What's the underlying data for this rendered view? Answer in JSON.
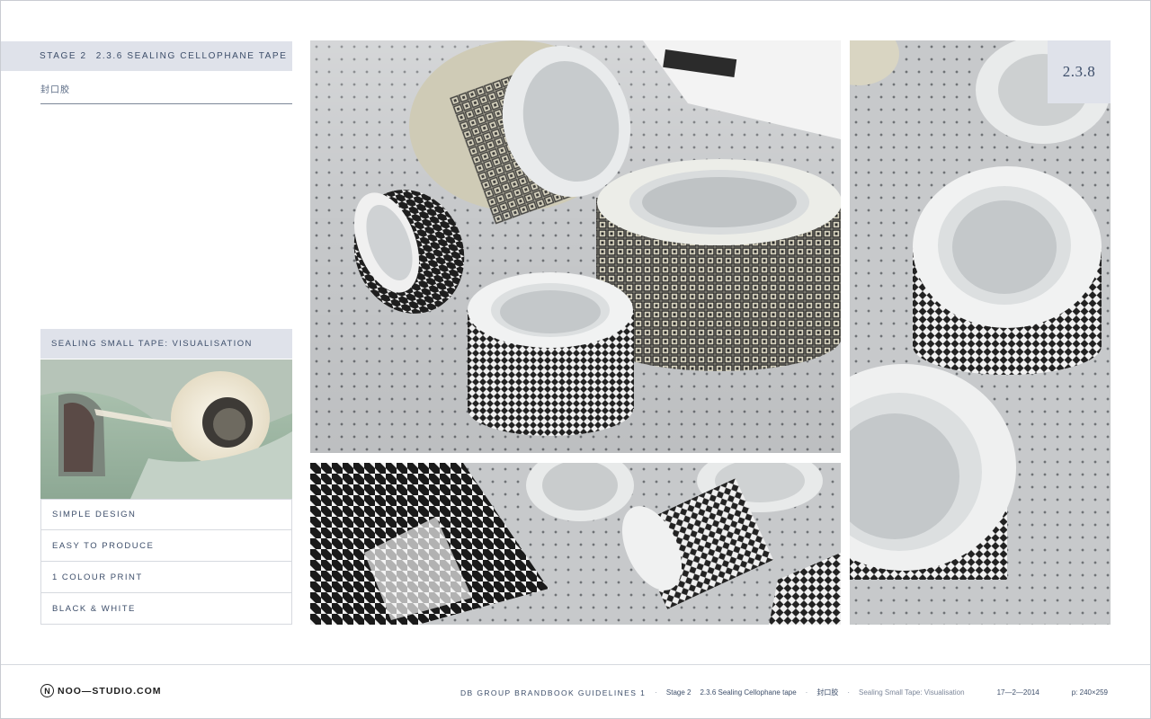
{
  "header": {
    "stage": "Stage 2",
    "section": "2.3.6 Sealing Cellophane tape",
    "chinese_label": "封口胶"
  },
  "visualisation": {
    "title": "Sealing Small Tape:  Visualisation",
    "features": [
      "Simple Design",
      "Easy to Produce",
      "1 Colour Print",
      "Black & White"
    ]
  },
  "page_badge": "2.3.8",
  "footer": {
    "logo": "NOO—STUDIO.COM",
    "brandbook": "DB GROUP BRANDBOOK GUIDELINES 1",
    "stage": "Stage 2",
    "section": "2.3.6 Sealing Cellophane tape",
    "chinese": "封口胶",
    "visualisation": "Sealing Small Tape: Visualisation",
    "date": "17—2—2014",
    "page": "p: 240×259"
  },
  "icons": {
    "logo_mark": "N"
  }
}
